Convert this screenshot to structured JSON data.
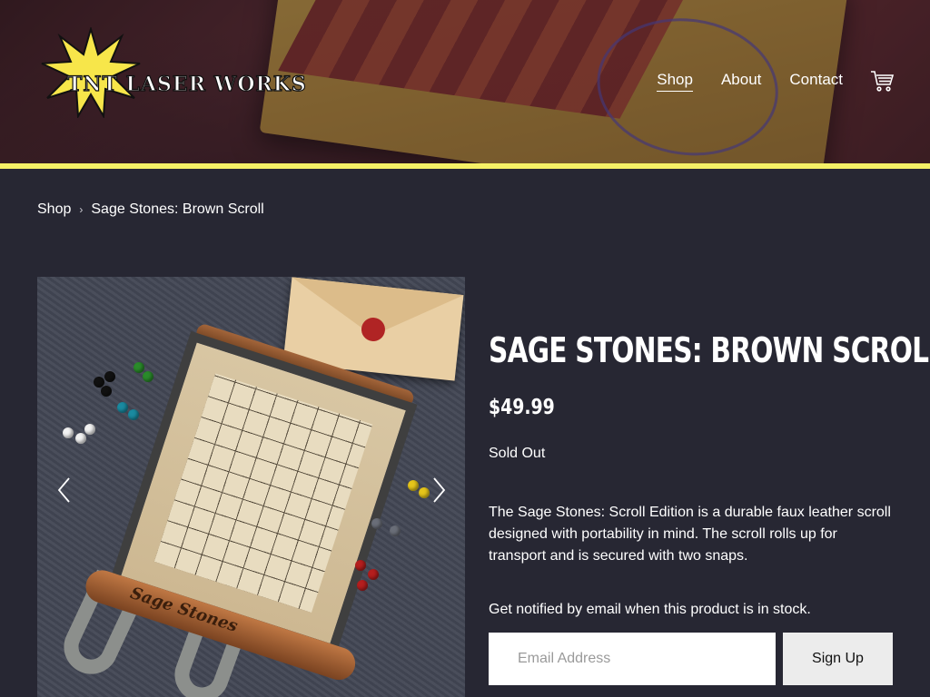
{
  "header": {
    "logo_text": "TNT LASER WORKS",
    "nav": [
      {
        "label": "Shop",
        "active": true
      },
      {
        "label": "About",
        "active": false
      },
      {
        "label": "Contact",
        "active": false
      }
    ],
    "cart_icon": "shopping-cart-icon",
    "accent_color": "#f5f066"
  },
  "breadcrumb": {
    "items": [
      "Shop",
      "Sage Stones: Brown Scroll"
    ],
    "separator_icon": "chevron-right-icon"
  },
  "gallery": {
    "prev_icon": "chevron-left-icon",
    "next_icon": "chevron-right-icon",
    "brand_text": "Sage Stones"
  },
  "product": {
    "title": "SAGE STONES: BROWN SCROLL",
    "price": "$49.99",
    "stock_status": "Sold Out",
    "description": "The Sage Stones: Scroll Edition is a durable faux leather scroll designed with portability in mind. The scroll rolls up for transport and is secured with two snaps.",
    "notify_text": "Get notified by email when this product is in stock.",
    "email_placeholder": "Email Address",
    "signup_label": "Sign Up"
  },
  "colors": {
    "page_bg": "#272733",
    "text": "#ffffff",
    "button_bg": "#ececec"
  }
}
